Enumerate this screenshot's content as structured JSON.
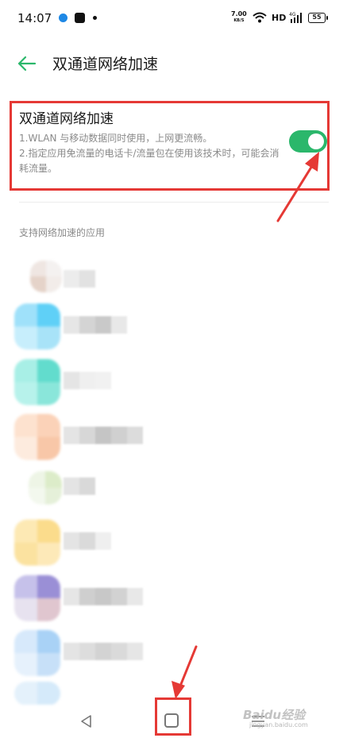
{
  "status_bar": {
    "time": "14:07",
    "net_speed_value": "7.00",
    "net_speed_unit": "KB/S",
    "hd_label": "HD",
    "battery": "55"
  },
  "header": {
    "title": "双通道网络加速"
  },
  "feature": {
    "title": "双通道网络加速",
    "desc_line1": "1.WLAN 与移动数据同时使用，上网更流畅。",
    "desc_line2": "2.指定应用免流量的电话卡/流量包在使用该技术时，可能会消耗流量。",
    "enabled": true,
    "accent_color": "#2bb76b"
  },
  "section": {
    "label": "支持网络加速的应用"
  },
  "watermark": {
    "text": "Baidu经验",
    "sub": "jingyan.baidu.com"
  },
  "colors": {
    "annotation_red": "#e53935"
  }
}
